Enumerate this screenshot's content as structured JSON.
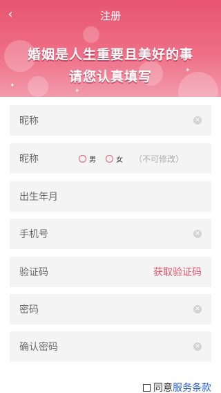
{
  "nav": {
    "title": "注册",
    "back_icon": "‹"
  },
  "banner": {
    "line1": "婚姻是人生重要且美好的事",
    "line2": "请您认真填写",
    "color": "#e8556f"
  },
  "form": {
    "nickname_placeholder": "昵称",
    "gender_label": "昵称",
    "gender_options": [
      "男",
      "女"
    ],
    "gender_note": "（不可修改）",
    "birth_placeholder": "出生年月",
    "phone_placeholder": "手机号",
    "code_placeholder": "验证码",
    "get_code_label": "获取验证码",
    "password_placeholder": "密码",
    "confirm_password_placeholder": "确认密码",
    "clear_icon": "✕"
  },
  "agree": {
    "prefix": "同意",
    "terms_link": "服务条款"
  },
  "colors": {
    "accent": "#e8556f",
    "link": "#2a5fd8"
  }
}
